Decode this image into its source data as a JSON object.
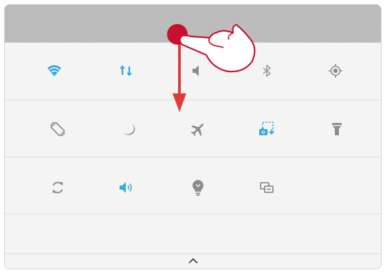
{
  "screen": "quick-settings-panel",
  "colors": {
    "accent": "#35a9e1",
    "icon_inactive": "#8c8c8c",
    "status_bar": "#bdbdbd",
    "panel_bg": "#f4f4f4",
    "gesture_marker": "#c8102e",
    "arrow": "#e03a3a"
  },
  "tiles": [
    {
      "row": 1,
      "icon": "wifi-icon",
      "active": true
    },
    {
      "row": 1,
      "icon": "mobile-data-icon",
      "active": true
    },
    {
      "row": 1,
      "icon": "sound-icon",
      "active": false
    },
    {
      "row": 1,
      "icon": "bluetooth-icon",
      "active": false
    },
    {
      "row": 1,
      "icon": "location-icon",
      "active": false
    },
    {
      "row": 2,
      "icon": "auto-rotate-icon",
      "active": false
    },
    {
      "row": 2,
      "icon": "night-mode-icon",
      "active": false
    },
    {
      "row": 2,
      "icon": "airplane-mode-icon",
      "active": false
    },
    {
      "row": 2,
      "icon": "screenshot-icon",
      "active": true
    },
    {
      "row": 2,
      "icon": "flashlight-icon",
      "active": false
    },
    {
      "row": 3,
      "icon": "sync-icon",
      "active": false
    },
    {
      "row": 3,
      "icon": "volume-icon",
      "active": true
    },
    {
      "row": 3,
      "icon": "lightbulb-icon",
      "active": false
    },
    {
      "row": 3,
      "icon": "screen-mirroring-icon",
      "active": false
    }
  ],
  "collapse_handle": "chevron-up-icon",
  "gesture": {
    "type": "swipe-down",
    "icon": "hand-pointer-icon"
  }
}
